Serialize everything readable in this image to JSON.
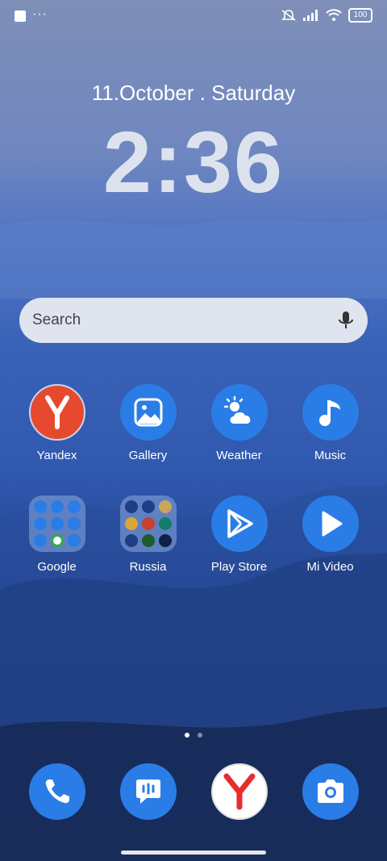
{
  "status_bar": {
    "battery": "100",
    "dots": "···"
  },
  "lockscreen": {
    "date": "11.October . Saturday",
    "time": "2:36"
  },
  "search": {
    "placeholder": "Search"
  },
  "apps": [
    {
      "label": "Yandex"
    },
    {
      "label": "Gallery"
    },
    {
      "label": "Weather"
    },
    {
      "label": "Music"
    },
    {
      "label": "Google"
    },
    {
      "label": "Russia"
    },
    {
      "label": "Play Store"
    },
    {
      "label": "Mi Video"
    }
  ],
  "dock": [
    "phone-icon",
    "messages-icon",
    "yandex-browser-icon",
    "camera-icon"
  ],
  "colors": {
    "accent": "#2a7de6",
    "yandex": "#e64a2e"
  }
}
